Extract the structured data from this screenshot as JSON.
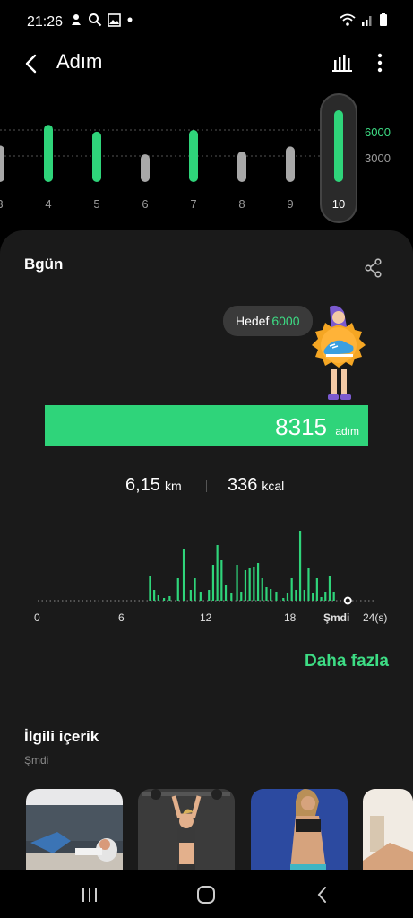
{
  "status_bar": {
    "time": "21:26",
    "left_icons": [
      "notification-icon",
      "search-icon",
      "image-icon",
      "dot-icon"
    ],
    "right_icons": [
      "wifi-icon",
      "signal-icon",
      "battery-icon"
    ]
  },
  "app_bar": {
    "title": "Adım",
    "back_icon": "chevron-left-icon",
    "chart_icon": "bar-chart-icon",
    "more_icon": "more-vertical-icon"
  },
  "weekly": {
    "goal_labels": [
      "6000",
      "3000"
    ],
    "days": [
      "3",
      "4",
      "5",
      "6",
      "7",
      "8",
      "9",
      "10"
    ],
    "selected_day": "10",
    "steps": [
      4200,
      6600,
      5800,
      3200,
      6000,
      3500,
      4100,
      8315
    ],
    "goal_met": [
      false,
      true,
      true,
      false,
      true,
      false,
      false,
      true
    ],
    "colors": {
      "met": "#2fd47a",
      "not_met": "#a8a8a8"
    }
  },
  "today": {
    "title": "Bgün",
    "share_icon": "share-icon",
    "goal_label": "Hedef",
    "goal_value": "6000",
    "steps_value": "8315",
    "steps_unit": "adım",
    "steps_fraction": 1.0,
    "distance_value": "6,15",
    "distance_unit": "km",
    "calories_value": "336",
    "calories_unit": "kcal"
  },
  "hourly_chart": {
    "x_labels": [
      "0",
      "6",
      "12",
      "18",
      "Şmdi",
      "24(s)"
    ],
    "colors": {
      "bar": "#2fd47a"
    },
    "chart_data": {
      "type": "bar",
      "x_range": [
        0,
        24
      ],
      "bars": [
        {
          "h": 8.0,
          "v": 28
        },
        {
          "h": 8.3,
          "v": 12
        },
        {
          "h": 8.6,
          "v": 6
        },
        {
          "h": 9.0,
          "v": 3
        },
        {
          "h": 9.4,
          "v": 5
        },
        {
          "h": 10.0,
          "v": 25
        },
        {
          "h": 10.4,
          "v": 58
        },
        {
          "h": 10.9,
          "v": 12
        },
        {
          "h": 11.2,
          "v": 25
        },
        {
          "h": 11.6,
          "v": 10
        },
        {
          "h": 12.2,
          "v": 12
        },
        {
          "h": 12.5,
          "v": 40
        },
        {
          "h": 12.8,
          "v": 62
        },
        {
          "h": 13.1,
          "v": 45
        },
        {
          "h": 13.4,
          "v": 18
        },
        {
          "h": 13.8,
          "v": 9
        },
        {
          "h": 14.2,
          "v": 40
        },
        {
          "h": 14.5,
          "v": 10
        },
        {
          "h": 14.8,
          "v": 34
        },
        {
          "h": 15.1,
          "v": 36
        },
        {
          "h": 15.4,
          "v": 38
        },
        {
          "h": 15.7,
          "v": 42
        },
        {
          "h": 16.0,
          "v": 25
        },
        {
          "h": 16.3,
          "v": 15
        },
        {
          "h": 16.6,
          "v": 13
        },
        {
          "h": 17.0,
          "v": 10
        },
        {
          "h": 17.5,
          "v": 3
        },
        {
          "h": 17.8,
          "v": 8
        },
        {
          "h": 18.1,
          "v": 25
        },
        {
          "h": 18.4,
          "v": 12
        },
        {
          "h": 18.7,
          "v": 78
        },
        {
          "h": 19.0,
          "v": 12
        },
        {
          "h": 19.3,
          "v": 36
        },
        {
          "h": 19.6,
          "v": 8
        },
        {
          "h": 19.9,
          "v": 25
        },
        {
          "h": 20.2,
          "v": 4
        },
        {
          "h": 20.5,
          "v": 10
        },
        {
          "h": 20.8,
          "v": 28
        },
        {
          "h": 21.1,
          "v": 10
        }
      ]
    }
  },
  "more_link": "Daha fazla",
  "related": {
    "title": "İlgili içerik",
    "subtitle": "Şmdi"
  },
  "nav": {
    "recent_icon": "recent-apps-icon",
    "home_icon": "home-icon",
    "back_icon": "back-icon"
  }
}
